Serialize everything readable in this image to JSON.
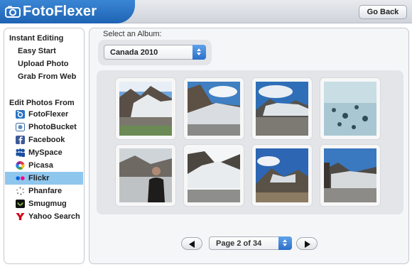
{
  "header": {
    "logo_text": "FotoFlexer",
    "go_back_label": "Go Back"
  },
  "sidebar": {
    "instant_heading": "Instant Editing",
    "instant_links": [
      "Easy Start",
      "Upload Photo",
      "Grab From Web"
    ],
    "sources_heading": "Edit Photos From",
    "sources": [
      {
        "label": "FotoFlexer",
        "icon": "fotoflexer-icon"
      },
      {
        "label": "PhotoBucket",
        "icon": "photobucket-icon"
      },
      {
        "label": "Facebook",
        "icon": "facebook-icon"
      },
      {
        "label": "MySpace",
        "icon": "myspace-icon"
      },
      {
        "label": "Picasa",
        "icon": "picasa-icon"
      },
      {
        "label": "Flickr",
        "icon": "flickr-icon",
        "selected": true
      },
      {
        "label": "Phanfare",
        "icon": "phanfare-icon"
      },
      {
        "label": "Smugmug",
        "icon": "smugmug-icon"
      },
      {
        "label": "Yahoo Search",
        "icon": "yahoo-icon"
      }
    ]
  },
  "album": {
    "label": "Select an Album:",
    "selected": "Canada 2010"
  },
  "pager": {
    "page_label": "Page 2 of 34"
  },
  "colors": {
    "brand_blue": "#2a73c4",
    "selected_source": "#8fc6ee"
  }
}
